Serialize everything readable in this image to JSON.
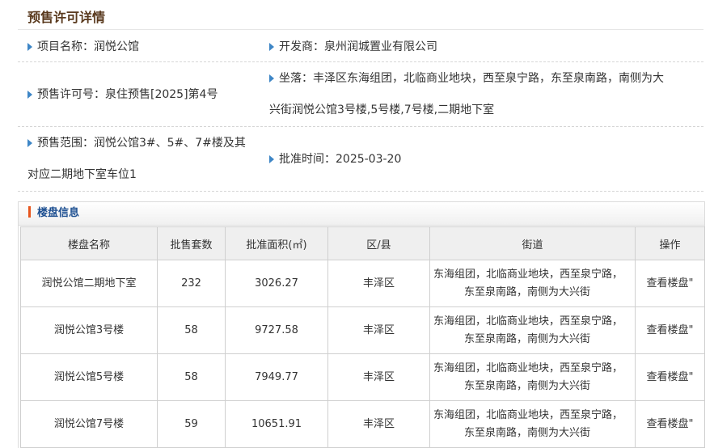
{
  "page": {
    "title": "预售许可详情"
  },
  "info": {
    "project_name": "项目名称：润悦公馆",
    "developer": "开发商：泉州润城置业有限公司",
    "permit_no": "预售许可号：泉住预售[2025]第4号",
    "location_line1": "坐落：丰泽区东海组团，北临商业地块，西至泉宁路，东至泉南路，南侧为大",
    "location_line2": "兴街润悦公馆3号楼,5号楼,7号楼,二期地下室",
    "scope_line1": "预售范围：润悦公馆3#、5#、7#楼及其",
    "scope_line2": "对应二期地下室车位1",
    "approval_time": "批准时间：2025-03-20"
  },
  "panel": {
    "title": "楼盘信息"
  },
  "table": {
    "headers": [
      "楼盘名称",
      "批售套数",
      "批准面积(㎡)",
      "区/县",
      "街道",
      "操作"
    ],
    "rows": [
      {
        "name": "润悦公馆二期地下室",
        "units": "232",
        "area": "3026.27",
        "district": "丰泽区",
        "street1": "东海组团，北临商业地块，西至泉宁路，",
        "street2": "东至泉南路，南侧为大兴街",
        "action": "查看楼盘\""
      },
      {
        "name": "润悦公馆3号楼",
        "units": "58",
        "area": "9727.58",
        "district": "丰泽区",
        "street1": "东海组团，北临商业地块，西至泉宁路，",
        "street2": "东至泉南路，南侧为大兴街",
        "action": "查看楼盘\""
      },
      {
        "name": "润悦公馆5号楼",
        "units": "58",
        "area": "7949.77",
        "district": "丰泽区",
        "street1": "东海组团，北临商业地块，西至泉宁路，",
        "street2": "东至泉南路，南侧为大兴街",
        "action": "查看楼盘\""
      },
      {
        "name": "润悦公馆7号楼",
        "units": "59",
        "area": "10651.91",
        "district": "丰泽区",
        "street1": "东海组团，北临商业地块，西至泉宁路，",
        "street2": "东至泉南路，南侧为大兴街",
        "action": "查看楼盘\""
      }
    ]
  },
  "colors": {
    "accent": "#3e86c6",
    "header_text": "#1d4f91",
    "marker": "#e7551d",
    "title": "#5a3a1e"
  }
}
